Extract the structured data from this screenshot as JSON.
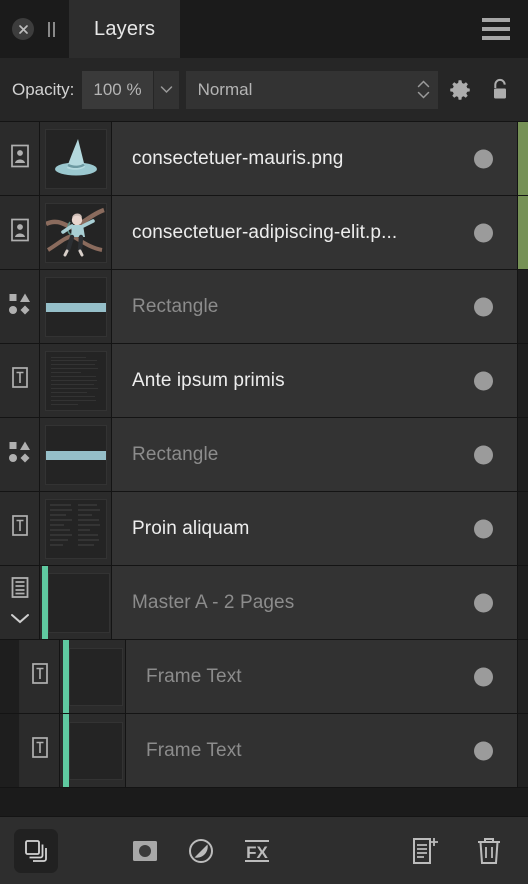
{
  "window": {
    "title": "Layers",
    "close_icon": "close-circle-icon",
    "grip_icon": "grip-bars-icon",
    "menu_icon": "hamburger-menu-icon"
  },
  "options_bar": {
    "opacity_label": "Opacity:",
    "opacity_value": "100 %",
    "opacity_caret_icon": "chevron-down-icon",
    "blend_mode": "Normal",
    "blend_stepper_icon": "stepper-updown-icon",
    "settings_icon": "gear-icon",
    "lock_icon": "lock-icon"
  },
  "layers": [
    {
      "name": "consectetuer-mauris.png",
      "type": "image",
      "type_icon": "image-layer-icon",
      "dimmed": false,
      "nested": false,
      "edge_accent": "#769156",
      "thumb": "hat-art"
    },
    {
      "name": "consectetuer-adipiscing-elit.p...",
      "type": "image",
      "type_icon": "image-layer-icon",
      "dimmed": false,
      "nested": false,
      "edge_accent": "#769156",
      "thumb": "figure-art"
    },
    {
      "name": "Rectangle",
      "type": "shape",
      "type_icon": "shapes-layer-icon",
      "dimmed": true,
      "nested": false,
      "edge_accent": "",
      "thumb": "rect-bar"
    },
    {
      "name": "Ante ipsum primis",
      "type": "text",
      "type_icon": "text-layer-icon",
      "dimmed": false,
      "nested": false,
      "edge_accent": "",
      "thumb": "text-lines"
    },
    {
      "name": "Rectangle",
      "type": "shape",
      "type_icon": "shapes-layer-icon",
      "dimmed": true,
      "nested": false,
      "edge_accent": "",
      "thumb": "rect-bar"
    },
    {
      "name": "Proin aliquam",
      "type": "text",
      "type_icon": "text-layer-icon",
      "dimmed": false,
      "nested": false,
      "edge_accent": "",
      "thumb": "text-cols"
    },
    {
      "name": "Master A - 2 Pages",
      "type": "master",
      "type_icon": "master-page-icon",
      "expand_icon": "chevron-down-icon",
      "dimmed": true,
      "nested": false,
      "inner_accent": "#5fc9a0",
      "edge_accent": "",
      "thumb": "empty"
    },
    {
      "name": "Frame Text",
      "type": "text",
      "type_icon": "text-layer-icon",
      "dimmed": true,
      "nested": true,
      "inner_accent": "#5fc9a0",
      "edge_accent": "",
      "thumb": "empty"
    },
    {
      "name": "Frame Text",
      "type": "text",
      "type_icon": "text-layer-icon",
      "dimmed": true,
      "nested": true,
      "inner_accent": "#5fc9a0",
      "edge_accent": "",
      "thumb": "empty"
    }
  ],
  "visibility_dot_tooltip": "",
  "bottom_bar": {
    "layers_toggle_icon": "layers-stack-icon",
    "mask_icon": "add-mask-icon",
    "adjustment_icon": "adjustment-layer-icon",
    "effects_icon": "fx-effects-icon",
    "add_layer_icon": "add-layer-icon",
    "delete_icon": "trash-icon"
  },
  "colors": {
    "panel_bg": "#1e1e1e",
    "row_bg": "#333333",
    "accent_green": "#769156",
    "accent_teal": "#5fc9a0",
    "thumb_blue": "#95bfc9"
  }
}
